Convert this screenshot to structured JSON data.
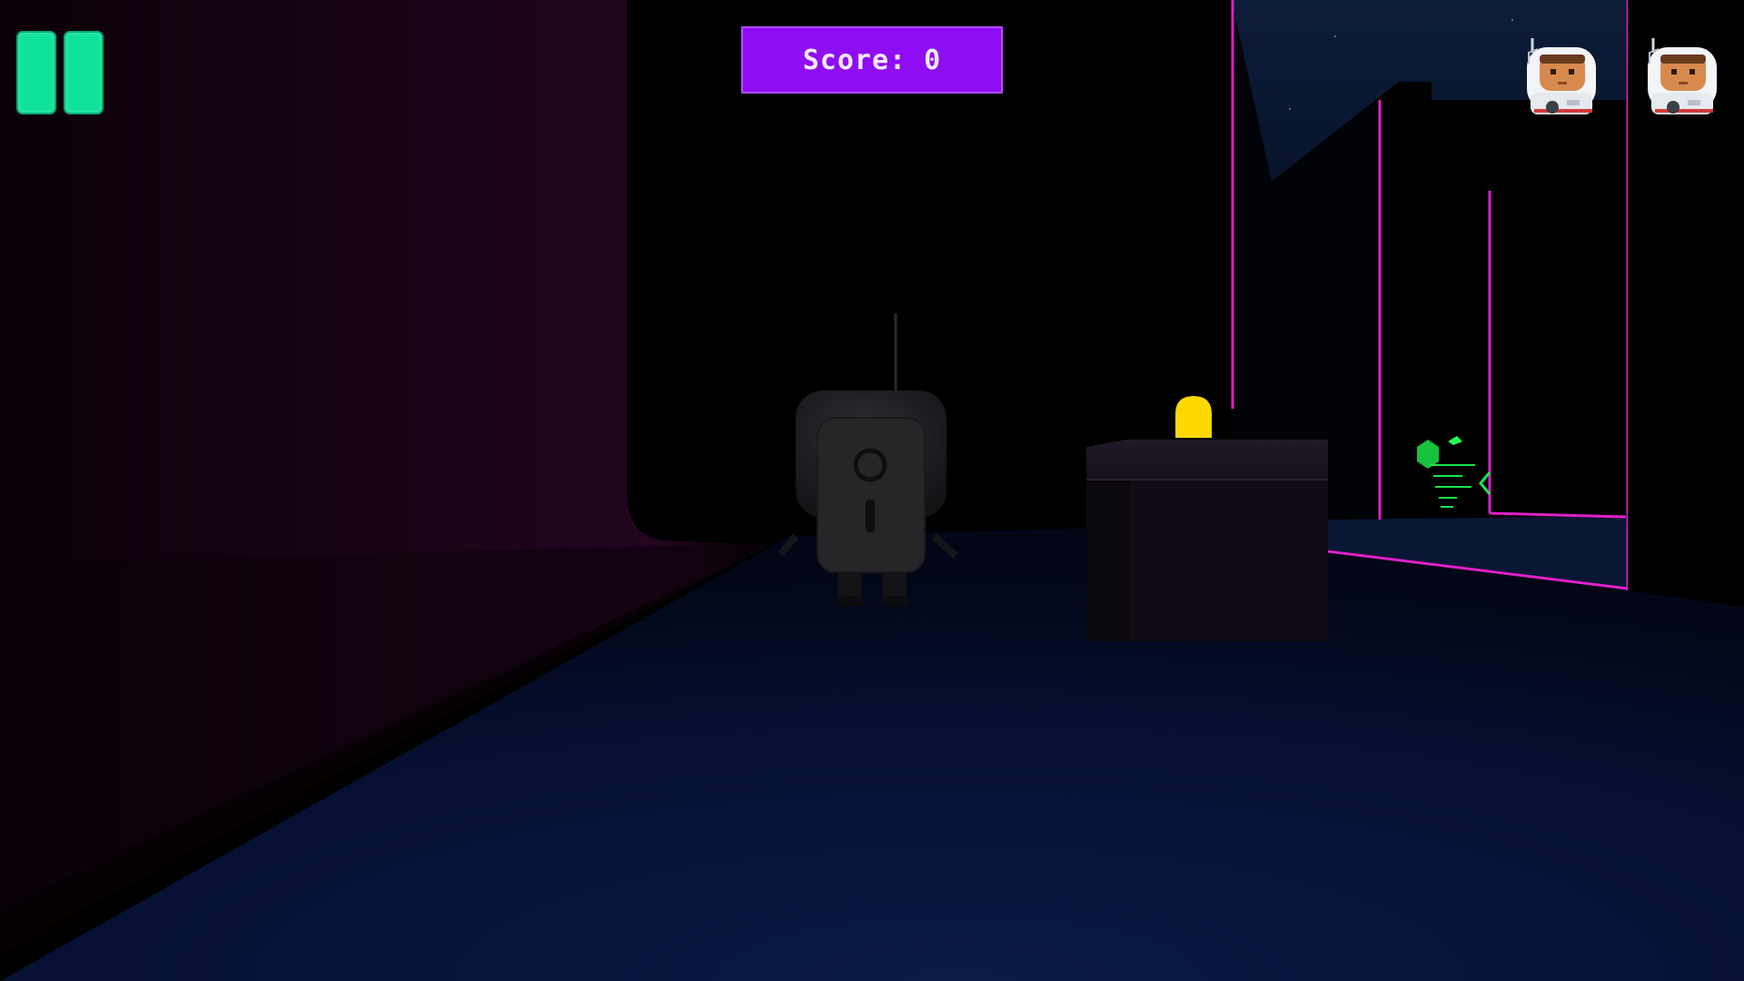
{
  "hud": {
    "score_label": "Score: 0",
    "lives_count": 2,
    "life_icon": "astronaut-icon",
    "pause_icon": "pause-icon"
  },
  "colors": {
    "pause_button": "#0fe39a",
    "score_panel": "#8f0df2",
    "neon_wall": "#e020c8",
    "beacon": "#ffd800",
    "pickup": "#1ee84a",
    "floor": "#071030"
  },
  "scene": {
    "character": "robot",
    "obstacle": "crate-with-yellow-beacon",
    "pickup": "green-energy-orb"
  }
}
